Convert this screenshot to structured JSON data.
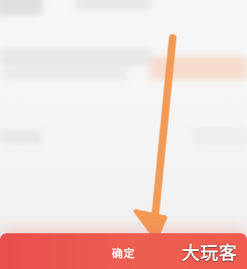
{
  "screen": {
    "bottom_bar": {
      "confirm_label": "确定",
      "background": "#ea554f"
    },
    "watermark": {
      "text": "大玩客"
    },
    "annotation": {
      "arrow_color": "#f29a55",
      "arrow_icon": "arrow-down-icon"
    }
  }
}
